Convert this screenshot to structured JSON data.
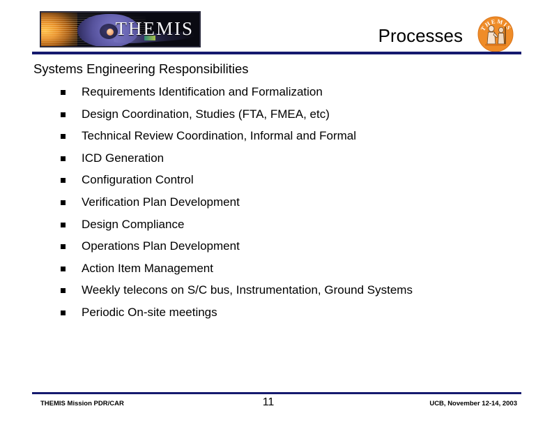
{
  "header": {
    "logo_banner": {
      "wordmark": "THEMIS",
      "icon": "themis-magnetosphere-artwork"
    },
    "title": "Processes",
    "seal": {
      "icon": "themis-seal-icon",
      "curved_text": "THEMIS",
      "color": "#ef8c28"
    },
    "rule_color": "#151a6e"
  },
  "body": {
    "section_heading": "Systems Engineering Responsibilities",
    "bullets": [
      {
        "text": "Requirements Identification and Formalization"
      },
      {
        "text": "Design Coordination, Studies (FTA, FMEA, etc)"
      },
      {
        "text": "Technical Review Coordination, Informal and Formal"
      },
      {
        "text": "ICD Generation"
      },
      {
        "text": "Configuration Control"
      },
      {
        "text": "Verification Plan Development"
      },
      {
        "text": "Design Compliance"
      },
      {
        "text": "Operations Plan Development"
      },
      {
        "text": "Action Item Management"
      },
      {
        "text": "Weekly telecons on S/C bus, Instrumentation, Ground Systems"
      },
      {
        "text": "Periodic On-site meetings"
      }
    ]
  },
  "footer": {
    "left": "THEMIS Mission PDR/CAR",
    "page_number": "11",
    "right": "UCB, November 12-14, 2003",
    "rule_color": "#151a6e"
  }
}
